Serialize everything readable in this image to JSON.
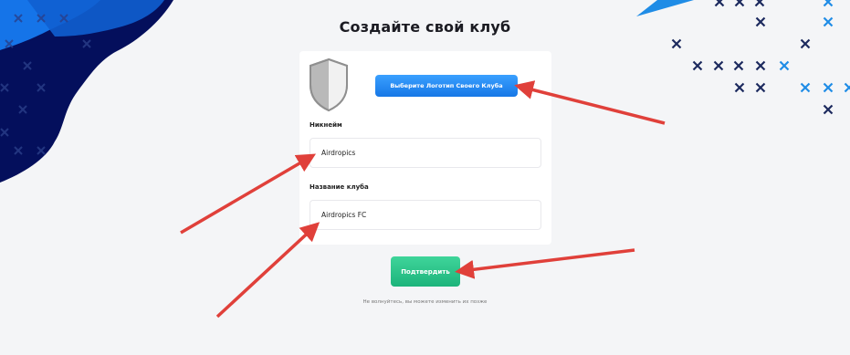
{
  "page": {
    "title": "Создайте свой клуб",
    "hint": "Не волнуйтесь, вы можете изменить их позже"
  },
  "logo": {
    "button_label": "Выберите Логотип Своего Клуба",
    "icon": "shield-icon"
  },
  "form": {
    "nickname_label": "Никнейм",
    "nickname_value": "Airdropics",
    "club_label": "Название клуба",
    "club_value": "Airdropics FC"
  },
  "actions": {
    "confirm_label": "Подтвердить"
  },
  "colors": {
    "background": "#f4f5f7",
    "dark_blob": "#040f5c",
    "blue_blob": "#1574e8",
    "logo_button": "#2f8ff5",
    "confirm_button": "#23c389",
    "arrow": "#e0403a",
    "cross_dark": "#1c2a5e",
    "cross_blue": "#1f8ce6"
  }
}
